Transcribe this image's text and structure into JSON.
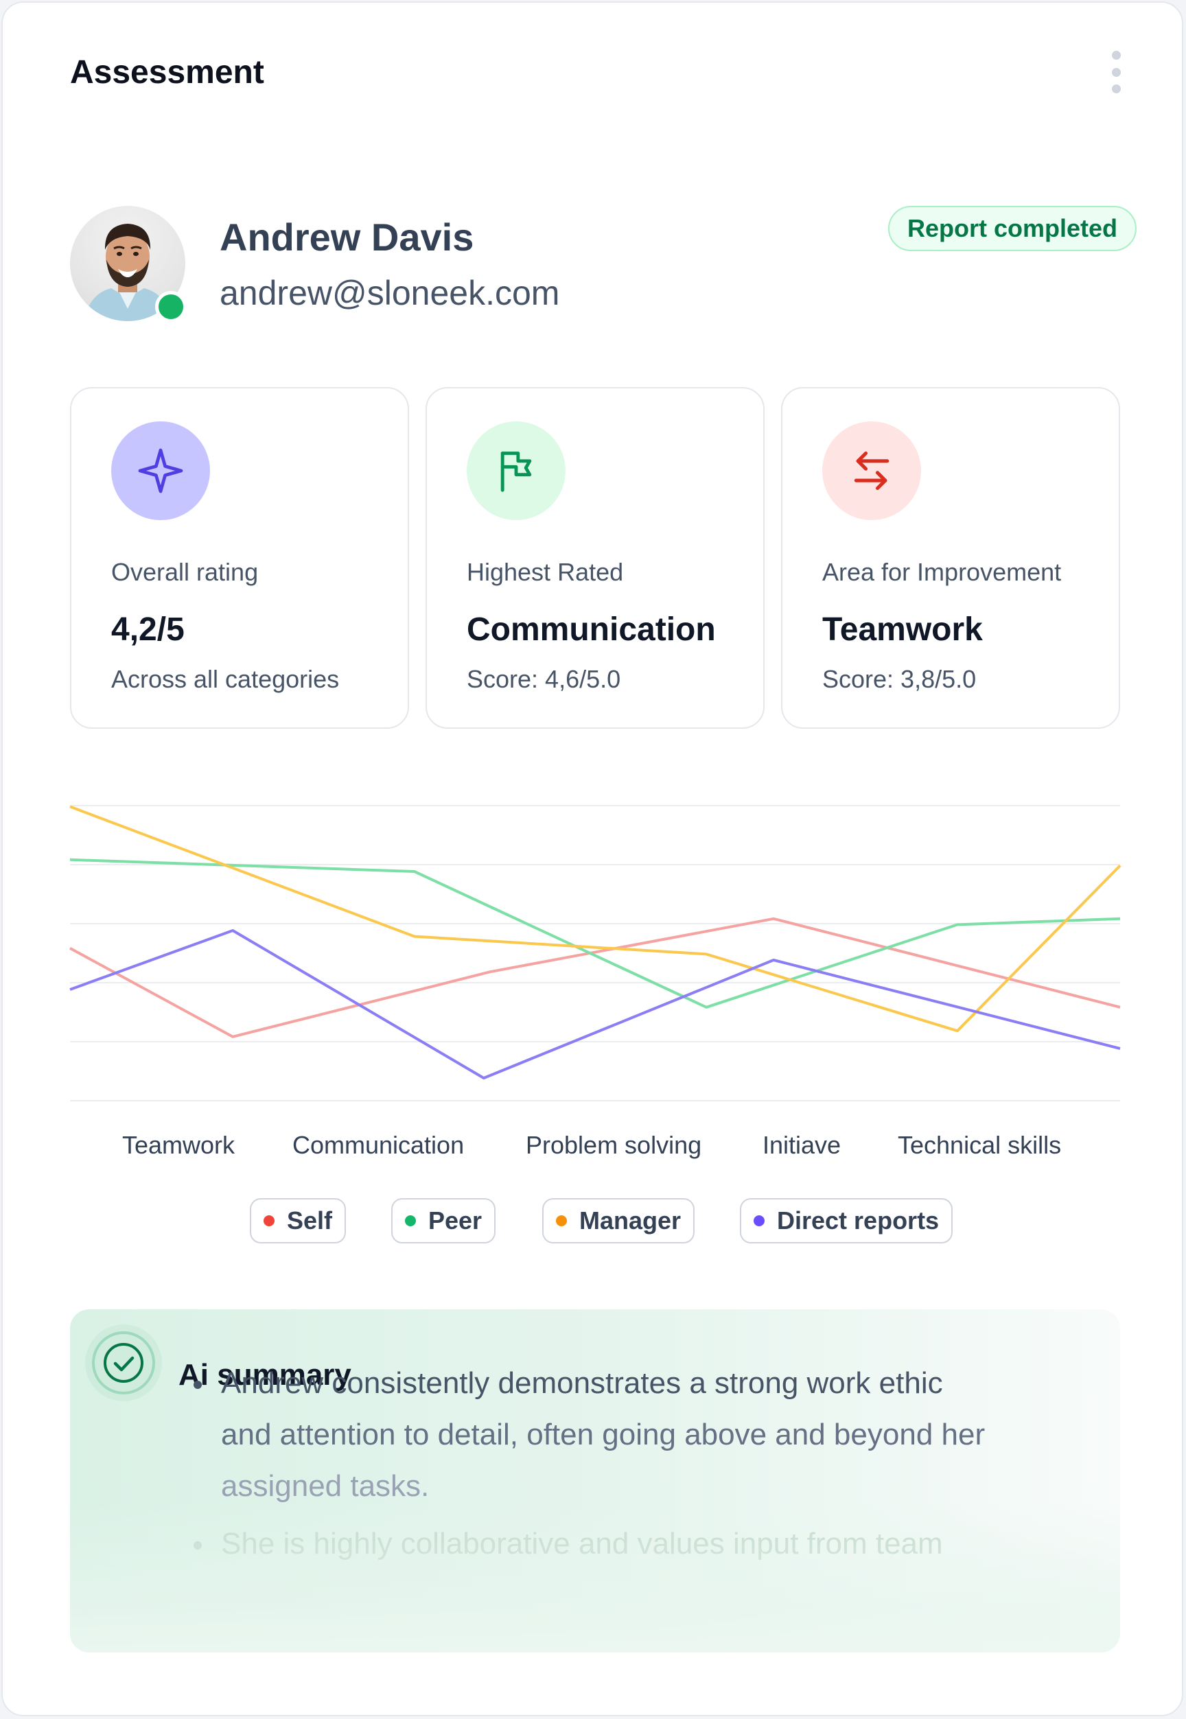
{
  "header": {
    "title": "Assessment",
    "menu_icon": "more-vertical-icon"
  },
  "profile": {
    "name": "Andrew Davis",
    "email": "andrew@sloneek.com",
    "status": "online",
    "badge": "Report completed"
  },
  "stats": [
    {
      "icon": "sparkle-icon",
      "icon_bg": "#c7c5ff",
      "icon_color": "#4f3fe0",
      "label": "Overall rating",
      "value": "4,2/5",
      "sub": "Across all categories"
    },
    {
      "icon": "flag-icon",
      "icon_bg": "#dcfae6",
      "icon_color": "#079455",
      "label": "Highest Rated",
      "value": "Communication",
      "sub": "Score: 4,6/5.0"
    },
    {
      "icon": "arrows-swap-icon",
      "icon_bg": "#fee4e2",
      "icon_color": "#d92d20",
      "label": "Area for Improvement",
      "value": "Teamwork",
      "sub": "Score: 3,8/5.0"
    }
  ],
  "chart_data": {
    "type": "line",
    "categories": [
      "Teamwork",
      "Communication",
      "Problem solving",
      "Initiave",
      "Technical skills"
    ],
    "grid": true,
    "ylim": [
      0,
      5
    ],
    "x_points": [
      0,
      0.155,
      0.32,
      0.4,
      0.6,
      0.67,
      0.845,
      1.0
    ],
    "series": [
      {
        "name": "Self",
        "legend_color": "#f04438",
        "line_color": "#f5a3a0",
        "x": [
          0,
          0.155,
          0.4,
          0.67,
          1.0
        ],
        "values": [
          2.7,
          1.2,
          2.3,
          3.2,
          1.7
        ]
      },
      {
        "name": "Peer",
        "legend_color": "#12b76a",
        "line_color": "#7ddfa6",
        "x": [
          0,
          0.328,
          0.606,
          0.845,
          1.0
        ],
        "values": [
          4.2,
          4.0,
          1.7,
          3.1,
          3.2
        ]
      },
      {
        "name": "Manager",
        "legend_color": "#f79009",
        "line_color": "#fbc84e",
        "x": [
          0,
          0.328,
          0.606,
          0.845,
          1.0
        ],
        "values": [
          5.1,
          2.9,
          2.6,
          1.3,
          4.1
        ]
      },
      {
        "name": "Direct reports",
        "legend_color": "#6b4dff",
        "line_color": "#8b7ef5",
        "x": [
          0,
          0.155,
          0.394,
          0.67,
          1.0
        ],
        "values": [
          2.0,
          3.0,
          0.5,
          2.5,
          1.0
        ]
      }
    ]
  },
  "summary": {
    "icon": "check-circle-icon",
    "title": "Ai summary",
    "bullets": [
      "Andrew consistently demonstrates a strong work ethic",
      "and attention to detail, often going above and beyond her",
      "assigned tasks.",
      "She is highly collaborative and values input from team"
    ]
  }
}
